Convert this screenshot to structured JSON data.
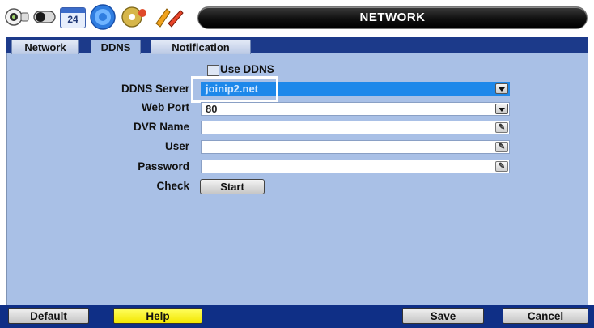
{
  "header": {
    "title": "NETWORK",
    "icons": [
      "camera-icon",
      "record-icon",
      "calendar-icon",
      "network-icon",
      "disc-icon",
      "tools-icon"
    ],
    "calendar_day": "24"
  },
  "tabs": [
    {
      "label": "Network",
      "active": false
    },
    {
      "label": "DDNS",
      "active": true
    },
    {
      "label": "Notification",
      "active": false
    }
  ],
  "form": {
    "use_ddns_label": "Use DDNS",
    "use_ddns_checked": false,
    "ddns_server_label": "DDNS Server",
    "ddns_server_value": "joinip2.net",
    "web_port_label": "Web Port",
    "web_port_value": "80",
    "dvr_name_label": "DVR Name",
    "dvr_name_value": "",
    "user_label": "User",
    "user_value": "",
    "password_label": "Password",
    "password_value": "",
    "check_label": "Check",
    "start_label": "Start"
  },
  "footer": {
    "default_label": "Default",
    "help_label": "Help",
    "save_label": "Save",
    "cancel_label": "Cancel"
  },
  "colors": {
    "panel": "#a9c0e6",
    "tabstrip": "#1c3a8a",
    "selected": "#1e88ea",
    "help": "#ffff00"
  }
}
